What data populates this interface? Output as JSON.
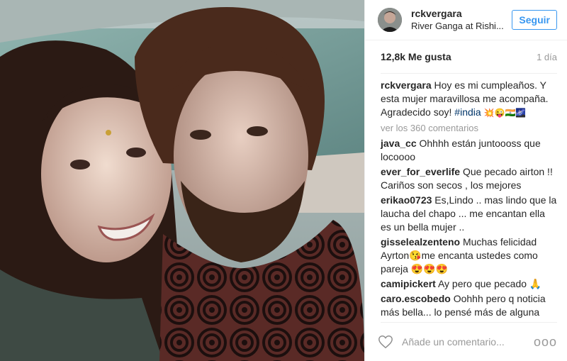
{
  "post": {
    "username": "rckvergara",
    "location": "River Ganga at Rishi...",
    "follow_label": "Seguir",
    "likes": "12,8k Me gusta",
    "time_ago": "1 día",
    "caption": {
      "user": "rckvergara",
      "text": "Hoy es mi cumpleaños. Y esta mujer maravillosa me acompaña. Agradecido soy!",
      "hashtag": "#india",
      "emojis": "💥😜🇮🇳🌌"
    },
    "view_comments_label": "ver los 360 comentarios",
    "comments": [
      {
        "user": "java_cc",
        "text": "Ohhhh están juntoooss que locoooo"
      },
      {
        "user": "ever_for_everlife",
        "text": "Que pecado airton !! Cariños son secos , los mejores"
      },
      {
        "user": "erikao0723",
        "text": "Es,Lindo .. mas lindo que la laucha del chapo ... me encantan ella es un bella mujer .."
      },
      {
        "user": "gisselealzenteno",
        "text": "Muchas felicidad Ayrton😘me encanta ustedes como pareja 😍😍😍"
      },
      {
        "user": "camipickert",
        "text": "Ay pero que pecado 🙏"
      },
      {
        "user": "caro.escobedo",
        "text": "Oohhh pero q noticia más bella... lo pensé más de alguna vez... por como se miraron mientras grabaron las últimas escenas juntos!! ♥ ♥"
      }
    ],
    "add_comment_placeholder": "Añade un comentario...",
    "more_options": "ooo"
  },
  "icons": {
    "like": "heart-outline-icon",
    "more": "more-options-icon"
  },
  "colors": {
    "accent": "#3897f0",
    "hashtag": "#003569",
    "muted": "#999999"
  }
}
